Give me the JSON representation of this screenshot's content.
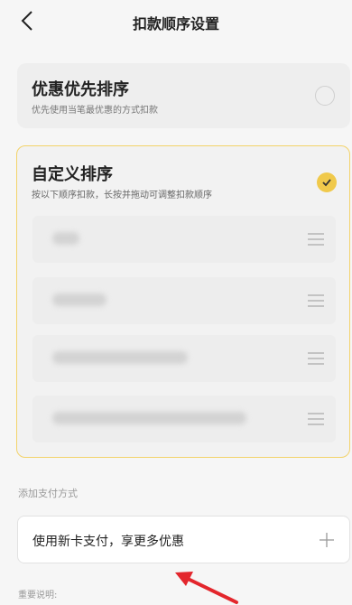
{
  "header": {
    "title": "扣款顺序设置"
  },
  "option_discount": {
    "title": "优惠优先排序",
    "subtitle": "优先使用当笔最优惠的方式扣款",
    "selected": false
  },
  "option_custom": {
    "title": "自定义排序",
    "subtitle": "按以下顺序扣款，长按并拖动可调整扣款顺序",
    "selected": true
  },
  "payment_methods": [
    {
      "label": "",
      "blur_width": 30
    },
    {
      "label": "",
      "blur_width": 60
    },
    {
      "label": "",
      "blur_width": 150
    },
    {
      "label": "",
      "blur_width": 215
    }
  ],
  "add_section": {
    "label": "添加支付方式",
    "new_card_text": "使用新卡支付，享更多优惠"
  },
  "footer": {
    "notes_label": "重要说明:"
  },
  "colors": {
    "accent": "#f0c94b",
    "accent_border": "#f3d36a",
    "arrow": "#e3262c"
  }
}
